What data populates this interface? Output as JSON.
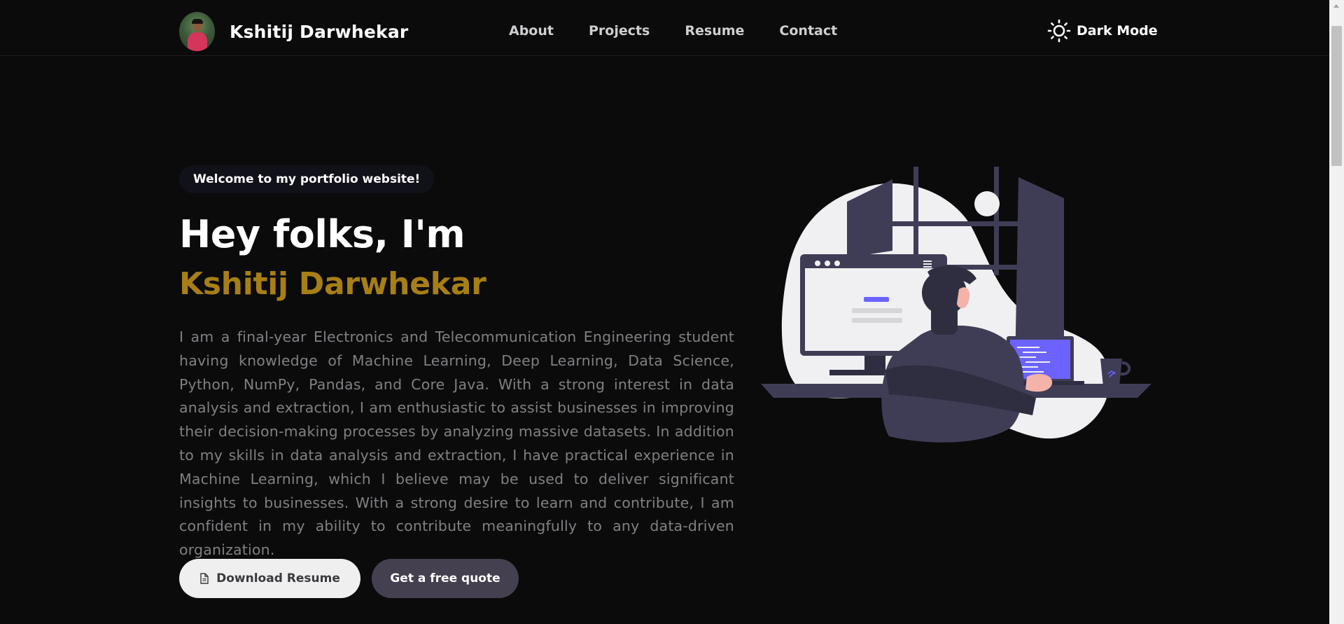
{
  "header": {
    "brand_name": "Kshitij Darwhekar",
    "nav": [
      {
        "label": "About"
      },
      {
        "label": "Projects"
      },
      {
        "label": "Resume"
      },
      {
        "label": "Contact"
      }
    ],
    "mode_toggle_label": "Dark Mode"
  },
  "hero": {
    "welcome": "Welcome to my portfolio website!",
    "greeting": "Hey folks, I'm",
    "name": "Kshitij Darwhekar",
    "description": "I am a final-year Electronics and Telecommunication Engineering student having knowledge of Machine Learning, Deep Learning, Data Science, Python, NumPy, Pandas, and Core Java. With a strong interest in data analysis and extraction, I am enthusiastic to assist businesses in improving their decision-making processes by analyzing massive datasets. In addition to my skills in data analysis and extraction, I have practical experience in Machine Learning, which I believe may be used to deliver significant insights to businesses. With a strong desire to learn and contribute, I am confident in my ability to contribute meaningfully to any data-driven organization.",
    "buttons": {
      "download": "Download Resume",
      "quote": "Get a free quote"
    }
  },
  "colors": {
    "background": "#0b0b0c",
    "accent_name": "#a77f16",
    "quote_button": "#45404f",
    "illustration_accent": "#6c63ff"
  },
  "icons": {
    "mode_toggle": "sun-icon",
    "download": "document-icon"
  }
}
